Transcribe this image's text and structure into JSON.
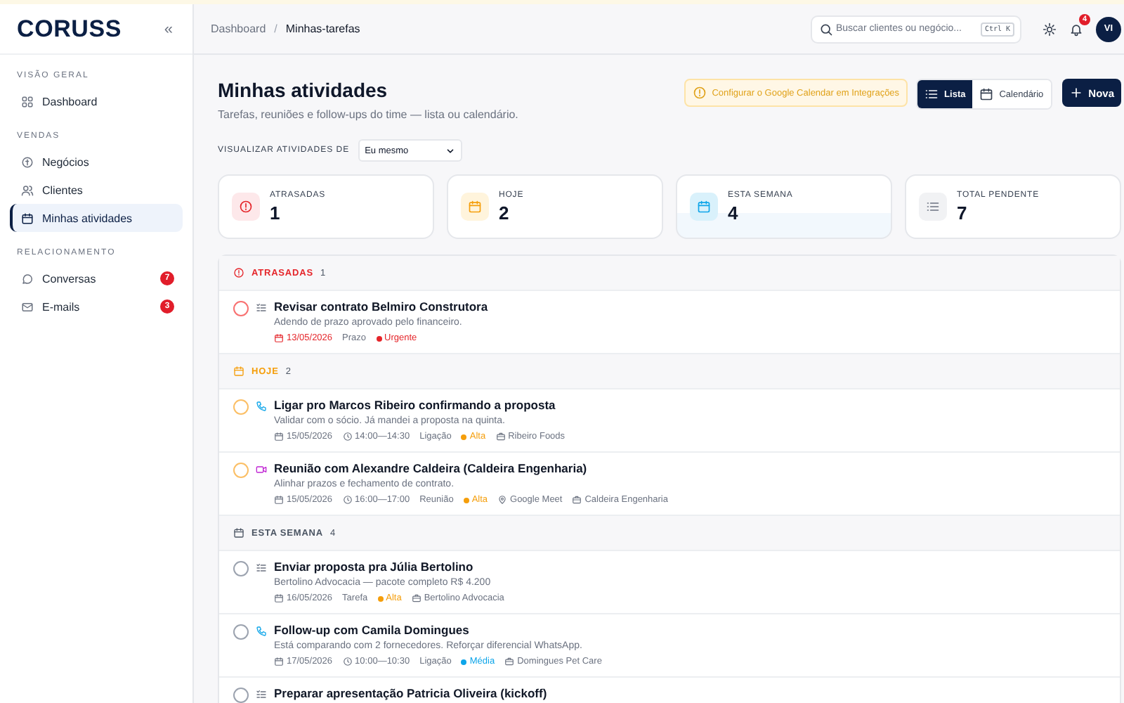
{
  "sidebar": {
    "logo": "CORUSS",
    "collapse": "«",
    "sections": [
      {
        "title": "VISÃO GERAL",
        "items": [
          {
            "label": "Dashboard",
            "selected": false
          }
        ]
      },
      {
        "title": "VENDAS",
        "items": [
          {
            "label": "Negócios",
            "selected": false
          },
          {
            "label": "Clientes",
            "selected": false
          },
          {
            "label": "Minhas atividades",
            "selected": true
          }
        ]
      },
      {
        "title": "RELACIONAMENTO",
        "items": [
          {
            "label": "Conversas",
            "selected": false,
            "badge": "7"
          },
          {
            "label": "E-mails",
            "selected": false,
            "badge": "3"
          }
        ]
      }
    ]
  },
  "topbar": {
    "breadcrumb": [
      "Dashboard",
      "Minhas-tarefas"
    ],
    "separator": "/",
    "search": {
      "placeholder": "Buscar clientes ou negócio...",
      "shortcut": "Ctrl K"
    },
    "notifications": "4",
    "avatar": "VI"
  },
  "header": {
    "title": "Minhas atividades",
    "subtitle": "Tarefas, reuniões e follow-ups do time — lista ou calendário.",
    "notice": "Configurar o Google Calendar em Integrações",
    "views": [
      {
        "label": "Lista",
        "selected": true
      },
      {
        "label": "Calendário",
        "selected": false
      }
    ],
    "new_button": "Nova"
  },
  "filter": {
    "label": "VISUALIZAR ATIVIDADES DE",
    "value": "Eu mesmo"
  },
  "stats": [
    {
      "kind": "overdue",
      "label": "ATRASADAS",
      "value": "1"
    },
    {
      "kind": "today",
      "label": "HOJE",
      "value": "2"
    },
    {
      "kind": "week",
      "label": "ESTA SEMANA",
      "value": "4"
    },
    {
      "kind": "total",
      "label": "TOTAL PENDENTE",
      "value": "7"
    }
  ],
  "groups": [
    {
      "kind": "overdue",
      "title": "ATRASADAS",
      "count": "1",
      "items": [
        {
          "kind": "task",
          "checked": false,
          "title": "Revisar contrato Belmiro Construtora",
          "description": "Adendo de prazo aprovado pelo financeiro.",
          "date": "13/05/2026",
          "type_label": "Prazo",
          "priority": {
            "label": "Urgente",
            "color": "#e5252a"
          }
        }
      ]
    },
    {
      "kind": "today",
      "title": "HOJE",
      "count": "2",
      "items": [
        {
          "kind": "call",
          "checked": false,
          "title": "Ligar pro Marcos Ribeiro confirmando a proposta",
          "description": "Validar com o sócio. Já mandei a proposta na quinta.",
          "date": "15/05/2026",
          "time": "14:00—14:30",
          "type_label": "Ligação",
          "priority": {
            "label": "Alta",
            "color": "#f59e0b"
          },
          "company": "Ribeiro Foods"
        },
        {
          "kind": "meeting",
          "checked": false,
          "title": "Reunião com Alexandre Caldeira (Caldeira Engenharia)",
          "description": "Alinhar prazos e fechamento de contrato.",
          "date": "15/05/2026",
          "time": "16:00—17:00",
          "type_label": "Reunião",
          "priority": {
            "label": "Alta",
            "color": "#f59e0b"
          },
          "location": "Google Meet",
          "company": "Caldeira Engenharia"
        }
      ]
    },
    {
      "kind": "week",
      "title": "ESTA SEMANA",
      "count": "4",
      "items": [
        {
          "kind": "task",
          "checked": false,
          "title": "Enviar proposta pra Júlia Bertolino",
          "description": "Bertolino Advocacia — pacote completo R$ 4.200",
          "date": "16/05/2026",
          "type_label": "Tarefa",
          "priority": {
            "label": "Alta",
            "color": "#f59e0b"
          },
          "company": "Bertolino Advocacia"
        },
        {
          "kind": "call",
          "checked": false,
          "title": "Follow-up com Camila Domingues",
          "description": "Está comparando com 2 fornecedores. Reforçar diferencial WhatsApp.",
          "date": "17/05/2026",
          "time": "10:00—10:30",
          "type_label": "Ligação",
          "priority": {
            "label": "Média",
            "color": "#0ea5e9"
          },
          "company": "Domingues Pet Care"
        },
        {
          "kind": "task",
          "checked": false,
          "title": "Preparar apresentação Patricia Oliveira (kickoff)"
        }
      ]
    }
  ]
}
